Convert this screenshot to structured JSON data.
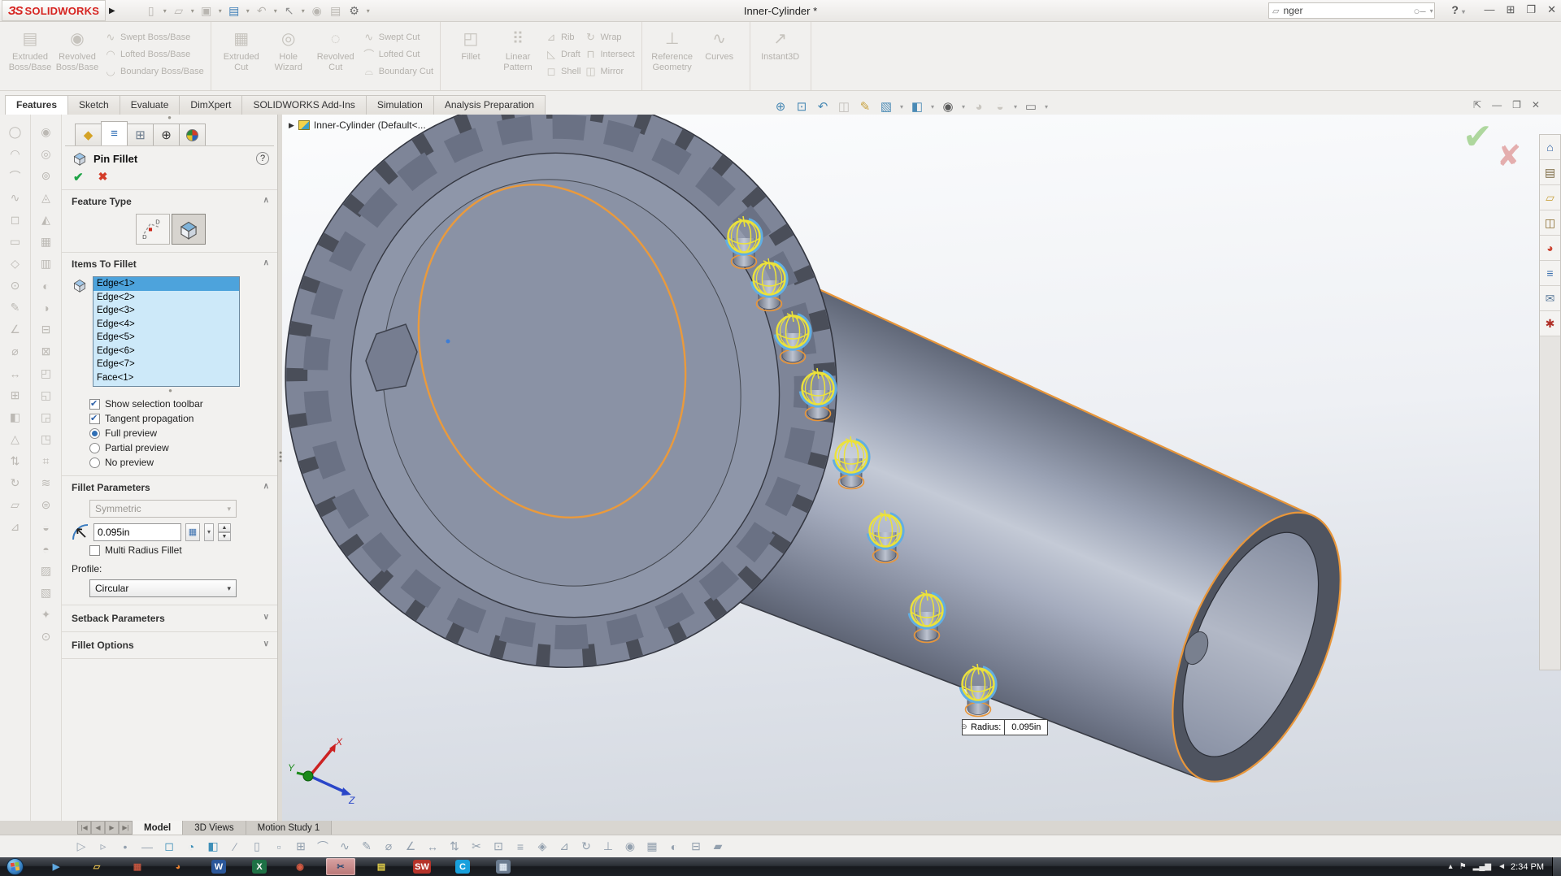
{
  "titlebar": {
    "logo_mark": "ЗS",
    "logo_name": "SOLIDWORKS",
    "expander": "▶",
    "title": "Inner-Cylinder *",
    "search_value": "nger",
    "help_label": "?",
    "win_minimize": "—",
    "win_split": "⊞",
    "win_restore": "❐",
    "win_close": "✕"
  },
  "qat": {
    "icons": [
      {
        "name": "new-document-button",
        "glyph": "▯"
      },
      {
        "name": "caret-icon",
        "glyph": "▾"
      },
      {
        "name": "open-button",
        "glyph": "▱"
      },
      {
        "name": "caret-icon",
        "glyph": "▾"
      },
      {
        "name": "save-button",
        "glyph": "▣"
      },
      {
        "name": "caret-icon",
        "glyph": "▾"
      },
      {
        "name": "print-button",
        "glyph": "▤",
        "color": "#3e7fb8"
      },
      {
        "name": "caret-icon",
        "glyph": "▾"
      },
      {
        "name": "undo-button",
        "glyph": "↶"
      },
      {
        "name": "caret-icon",
        "glyph": "▾"
      },
      {
        "name": "select-button",
        "glyph": "↖",
        "color": "#8f8f8f"
      },
      {
        "name": "caret-icon",
        "glyph": "▾"
      },
      {
        "name": "toggle-button",
        "glyph": "◉"
      },
      {
        "name": "file-properties-button",
        "glyph": "▤"
      },
      {
        "name": "options-button",
        "glyph": "⚙",
        "color": "#6f6f6f"
      },
      {
        "name": "caret-icon",
        "glyph": "▾"
      }
    ]
  },
  "ribbon": {
    "groups": [
      {
        "big": [
          {
            "name": "extruded-boss-base-button",
            "glyph": "▤",
            "label": "Extruded Boss/Base"
          },
          {
            "name": "revolved-boss-base-button",
            "glyph": "◉",
            "label": "Revolved Boss/Base"
          }
        ],
        "stack": [
          {
            "name": "swept-boss-base-button",
            "glyph": "∿",
            "label": "Swept Boss/Base"
          },
          {
            "name": "lofted-boss-base-button",
            "glyph": "◠",
            "label": "Lofted Boss/Base"
          },
          {
            "name": "boundary-boss-base-button",
            "glyph": "◡",
            "label": "Boundary Boss/Base"
          }
        ]
      },
      {
        "big": [
          {
            "name": "extruded-cut-button",
            "glyph": "▦",
            "label": "Extruded Cut"
          },
          {
            "name": "hole-wizard-button",
            "glyph": "◎",
            "label": "Hole Wizard"
          },
          {
            "name": "revolved-cut-button",
            "glyph": "◌",
            "label": "Revolved Cut"
          }
        ],
        "stack": [
          {
            "name": "swept-cut-button",
            "glyph": "∿",
            "label": "Swept Cut"
          },
          {
            "name": "lofted-cut-button",
            "glyph": "⌒",
            "label": "Lofted Cut"
          },
          {
            "name": "boundary-cut-button",
            "glyph": "⌓",
            "label": "Boundary Cut"
          }
        ]
      },
      {
        "big": [
          {
            "name": "fillet-button",
            "glyph": "◰",
            "label": "Fillet"
          },
          {
            "name": "linear-pattern-button",
            "glyph": "⠿",
            "label": "Linear Pattern"
          }
        ],
        "stack": [
          {
            "name": "rib-button",
            "glyph": "⊿",
            "label": "Rib"
          },
          {
            "name": "draft-button",
            "glyph": "◺",
            "label": "Draft"
          },
          {
            "name": "shell-button",
            "glyph": "◻",
            "label": "Shell"
          }
        ],
        "stack2": [
          {
            "name": "wrap-button",
            "glyph": "↻",
            "label": "Wrap"
          },
          {
            "name": "intersect-button",
            "glyph": "⊓",
            "label": "Intersect"
          },
          {
            "name": "mirror-button",
            "glyph": "◫",
            "label": "Mirror"
          }
        ]
      },
      {
        "big": [
          {
            "name": "reference-geometry-button",
            "glyph": "⊥",
            "label": "Reference Geometry"
          },
          {
            "name": "curves-button",
            "glyph": "∿",
            "label": "Curves"
          }
        ]
      },
      {
        "big": [
          {
            "name": "instant3d-button",
            "glyph": "↗",
            "label": "Instant3D"
          }
        ]
      }
    ]
  },
  "tabs": {
    "items": [
      {
        "label": "Features",
        "active": true
      },
      {
        "label": "Sketch"
      },
      {
        "label": "Evaluate"
      },
      {
        "label": "DimXpert"
      },
      {
        "label": "SOLIDWORKS Add-Ins"
      },
      {
        "label": "Simulation"
      },
      {
        "label": "Analysis Preparation"
      }
    ]
  },
  "headsup": {
    "icons": [
      {
        "name": "zoom-fit-icon",
        "glyph": "⊕",
        "color": "#4a8ab5"
      },
      {
        "name": "zoom-area-icon",
        "glyph": "⊡",
        "color": "#4a8ab5"
      },
      {
        "name": "previous-view-icon",
        "glyph": "↶",
        "color": "#4a8ab5"
      },
      {
        "name": "section-view-icon",
        "glyph": "◫",
        "color": "#c2bfba"
      },
      {
        "name": "measure-icon",
        "glyph": "✎",
        "color": "#c8a13e"
      },
      {
        "name": "view-orientation-icon",
        "glyph": "▧",
        "color": "#4a8ab5"
      },
      {
        "name": "caret-icon",
        "glyph": "▾"
      },
      {
        "name": "display-style-icon",
        "glyph": "◧",
        "color": "#4a8ab5"
      },
      {
        "name": "caret-icon",
        "glyph": "▾"
      },
      {
        "name": "hide-show-items-icon",
        "glyph": "◉",
        "color": "#5a5a5a"
      },
      {
        "name": "caret-icon",
        "glyph": "▾"
      },
      {
        "name": "edit-appearance-icon",
        "glyph": "◕",
        "color": "#c9c6c0"
      },
      {
        "name": "apply-scene-icon",
        "glyph": "◒",
        "color": "#c9c6c0"
      },
      {
        "name": "caret-icon",
        "glyph": "▾"
      },
      {
        "name": "view-settings-icon",
        "glyph": "▭",
        "color": "#7a7a7a"
      },
      {
        "name": "caret-icon",
        "glyph": "▾"
      }
    ]
  },
  "doccontrols": {
    "pin": "⇱",
    "minimize": "—",
    "restore": "❐",
    "close": "✕"
  },
  "left_toolbar_a": {
    "icons": [
      {
        "name": "sketch-tool-icon",
        "glyph": "◯"
      },
      {
        "name": "arc-tool-icon",
        "glyph": "◠"
      },
      {
        "name": "tangent-arc-icon",
        "glyph": "⌒"
      },
      {
        "name": "spline-tool-icon",
        "glyph": "∿"
      },
      {
        "name": "rectangle-tool-icon",
        "glyph": "◻"
      },
      {
        "name": "slot-tool-icon",
        "glyph": "▭"
      },
      {
        "name": "polygon-tool-icon",
        "glyph": "◇"
      },
      {
        "name": "point-tool-icon",
        "glyph": "⊙"
      },
      {
        "name": "text-tool-icon",
        "glyph": "✎"
      },
      {
        "name": "angle-dimension-icon",
        "glyph": "∠"
      },
      {
        "name": "diameter-dimension-icon",
        "glyph": "⌀"
      },
      {
        "name": "horizontal-dimension-icon",
        "glyph": "↔"
      },
      {
        "name": "pattern-tool-icon",
        "glyph": "⊞"
      },
      {
        "name": "shaded-view-icon",
        "glyph": "◧"
      },
      {
        "name": "triangle-tool-icon",
        "glyph": "△"
      },
      {
        "name": "swap-tool-icon",
        "glyph": "⇅"
      },
      {
        "name": "rotate-tool-icon",
        "glyph": "↻"
      },
      {
        "name": "plane-tool-icon",
        "glyph": "▱"
      },
      {
        "name": "chamfer-tool-icon",
        "glyph": "⊿"
      }
    ]
  },
  "left_toolbar_b": {
    "icons": [
      {
        "name": "circle-feature-icon",
        "glyph": "◉"
      },
      {
        "name": "hole-feature-icon",
        "glyph": "◎"
      },
      {
        "name": "boss-feature-icon",
        "glyph": "⊚"
      },
      {
        "name": "pyramid-feature-icon",
        "glyph": "◬"
      },
      {
        "name": "wedge-feature-icon",
        "glyph": "◭"
      },
      {
        "name": "grid-feature-icon",
        "glyph": "▦"
      },
      {
        "name": "hatch-feature-icon",
        "glyph": "▥"
      },
      {
        "name": "half-shade-icon",
        "glyph": "◐"
      },
      {
        "name": "half-shade-right-icon",
        "glyph": "◑"
      },
      {
        "name": "minus-box-icon",
        "glyph": "⊟"
      },
      {
        "name": "cross-box-icon",
        "glyph": "⊠"
      },
      {
        "name": "corner-tl-icon",
        "glyph": "◰"
      },
      {
        "name": "corner-bl-icon",
        "glyph": "◱"
      },
      {
        "name": "corner-br-icon",
        "glyph": "◲"
      },
      {
        "name": "corner-tr-icon",
        "glyph": "◳"
      },
      {
        "name": "hash-icon",
        "glyph": "⌗"
      },
      {
        "name": "wave-icon",
        "glyph": "≋"
      },
      {
        "name": "ring-icon",
        "glyph": "⊜"
      },
      {
        "name": "bottom-shade-icon",
        "glyph": "◒"
      },
      {
        "name": "top-shade-icon",
        "glyph": "◓"
      },
      {
        "name": "diag-hatch-icon",
        "glyph": "▨"
      },
      {
        "name": "diag-hatch2-icon",
        "glyph": "▧"
      },
      {
        "name": "star-icon",
        "glyph": "✦"
      },
      {
        "name": "dot-icon",
        "glyph": "⊙"
      }
    ]
  },
  "panel": {
    "handle": "●",
    "tabs": [
      {
        "name": "panel-tab-featuremanager",
        "glyph": "◆",
        "color": "#d4a226"
      },
      {
        "name": "panel-tab-propertymanager",
        "glyph": "≡",
        "color": "#2e6db5",
        "active": true
      },
      {
        "name": "panel-tab-configurationmanager",
        "glyph": "⊞",
        "color": "#6b7b8c"
      },
      {
        "name": "panel-tab-dimxpertmanager",
        "glyph": "⊕",
        "color": "#333333"
      },
      {
        "name": "panel-tab-displaymanager",
        "glyph": "●",
        "color": "#cc3333"
      }
    ],
    "title": "Pin Fillet",
    "help": "?",
    "ok": "✔",
    "cancel": "✖",
    "feature_type_label": "Feature Type",
    "items_label": "Items To Fillet",
    "items": [
      {
        "label": "Edge<1>",
        "selected": true
      },
      {
        "label": "Edge<2>"
      },
      {
        "label": "Edge<3>"
      },
      {
        "label": "Edge<4>"
      },
      {
        "label": "Edge<5>"
      },
      {
        "label": "Edge<6>"
      },
      {
        "label": "Edge<7>"
      },
      {
        "label": "Face<1>"
      }
    ],
    "show_selection_toolbar": "Show selection toolbar",
    "tangent_propagation": "Tangent propagation",
    "full_preview": "Full preview",
    "partial_preview": "Partial preview",
    "no_preview": "No preview",
    "fillet_params_label": "Fillet Parameters",
    "symmetric": "Symmetric",
    "radius_value": "0.095in",
    "multi_radius": "Multi Radius Fillet",
    "profile_label": "Profile:",
    "profile_value": "Circular",
    "setback_label": "Setback Parameters",
    "fillet_options_label": "Fillet Options"
  },
  "viewport": {
    "tree_item": "Inner-Cylinder  (Default<...",
    "confirm_ok": "✔",
    "confirm_cancel": "✘",
    "callout": {
      "label": "Radius:",
      "value": "0.095in"
    },
    "triad": {
      "x": "X",
      "y": "Y",
      "z": "Z"
    }
  },
  "right_pane": {
    "icons": [
      {
        "name": "home-icon",
        "glyph": "⌂",
        "color": "#2b5fa3"
      },
      {
        "name": "design-library-icon",
        "glyph": "▤",
        "color": "#7a6840"
      },
      {
        "name": "file-explorer-icon",
        "glyph": "▱",
        "color": "#c9a23e"
      },
      {
        "name": "view-palette-icon",
        "glyph": "◫",
        "color": "#8a6d2f"
      },
      {
        "name": "appearances-icon",
        "glyph": "◕",
        "color": "#cc4433"
      },
      {
        "name": "custom-properties-icon",
        "glyph": "≡",
        "color": "#3a6fae"
      },
      {
        "name": "forum-icon",
        "glyph": "✉",
        "color": "#5a7a9a"
      },
      {
        "name": "solidworks-resources-icon",
        "glyph": "✱",
        "color": "#b03028"
      }
    ]
  },
  "doc_tabs": {
    "nav": [
      "|◀",
      "◀",
      "▶",
      "▶|"
    ],
    "items": [
      {
        "label": "Model",
        "active": true
      },
      {
        "label": "3D Views"
      },
      {
        "label": "Motion Study 1"
      }
    ]
  },
  "sketchbar": {
    "icons": [
      {
        "name": "select-arrow-icon",
        "glyph": "▷",
        "color": "#9aa5b1"
      },
      {
        "name": "lasso-select-icon",
        "glyph": "▹",
        "color": "#9aa5b1"
      },
      {
        "name": "point-icon",
        "glyph": "•"
      },
      {
        "name": "centerline-icon",
        "glyph": "—"
      },
      {
        "name": "square-icon",
        "glyph": "◻",
        "color": "#3e8fb8"
      },
      {
        "name": "sphere-icon",
        "glyph": "◔",
        "color": "#3e8fb8"
      },
      {
        "name": "cube-icon",
        "glyph": "◧",
        "color": "#3e8fb8"
      },
      {
        "name": "line-icon",
        "glyph": "∕"
      },
      {
        "name": "plane-icon",
        "glyph": "▯"
      },
      {
        "name": "small-rect-icon",
        "glyph": "▫"
      },
      {
        "name": "grid-icon",
        "glyph": "⊞"
      },
      {
        "name": "arc-icon",
        "glyph": "⌒"
      },
      {
        "name": "spline-icon",
        "glyph": "∿"
      },
      {
        "name": "annotate-icon",
        "glyph": "✎"
      },
      {
        "name": "diameter-icon",
        "glyph": "⌀"
      },
      {
        "name": "angle-icon",
        "glyph": "∠"
      },
      {
        "name": "horizontal-icon",
        "glyph": "↔"
      },
      {
        "name": "vertical-swap-icon",
        "glyph": "⇅"
      },
      {
        "name": "trim-icon",
        "glyph": "✂"
      },
      {
        "name": "zoom-box-icon",
        "glyph": "⊡"
      },
      {
        "name": "list-icon",
        "glyph": "≡"
      },
      {
        "name": "diamond-icon",
        "glyph": "◈"
      },
      {
        "name": "triangle-icon",
        "glyph": "⊿"
      },
      {
        "name": "rotate-icon",
        "glyph": "↻"
      },
      {
        "name": "perpendicular-icon",
        "glyph": "⊥"
      },
      {
        "name": "target-icon",
        "glyph": "◉"
      },
      {
        "name": "mesh-icon",
        "glyph": "▦"
      },
      {
        "name": "half-icon",
        "glyph": "◐"
      },
      {
        "name": "minus-icon",
        "glyph": "⊟"
      },
      {
        "name": "block-icon",
        "glyph": "▰"
      }
    ]
  },
  "taskbar": {
    "apps": [
      {
        "name": "taskbar-app-media",
        "glyph": "▶",
        "color": "#5fa8e0"
      },
      {
        "name": "taskbar-app-explorer",
        "glyph": "▱",
        "color": "#e7c04f"
      },
      {
        "name": "taskbar-app-menu",
        "glyph": "▦",
        "color": "#c0543e"
      },
      {
        "name": "taskbar-app-firefox",
        "glyph": "◕",
        "color": "#e87f2e"
      },
      {
        "name": "taskbar-app-word",
        "glyph": "W",
        "color": "#ffffff",
        "bg": "#2b579a"
      },
      {
        "name": "taskbar-app-excel",
        "glyph": "X",
        "color": "#ffffff",
        "bg": "#1e7145"
      },
      {
        "name": "taskbar-app-chrome",
        "glyph": "◉",
        "color": "#d95b43"
      },
      {
        "name": "taskbar-app-snipping-tool",
        "glyph": "✂",
        "color": "#2b4b72",
        "active": true
      },
      {
        "name": "taskbar-app-sticky-notes",
        "glyph": "▤",
        "color": "#e8d44a"
      },
      {
        "name": "taskbar-app-solidworks",
        "glyph": "SW",
        "color": "#ffffff",
        "bg": "#b5332a"
      },
      {
        "name": "taskbar-app-camtasia",
        "glyph": "C",
        "color": "#ffffff",
        "bg": "#18a0dc"
      },
      {
        "name": "taskbar-app-calculator",
        "glyph": "▦",
        "color": "#dce6f0",
        "bg": "#6b7c90"
      }
    ],
    "tray": [
      {
        "name": "tray-expand-icon",
        "glyph": "▴"
      },
      {
        "name": "tray-flag-icon",
        "glyph": "⚑"
      },
      {
        "name": "tray-network-icon",
        "glyph": "▂▄▆"
      },
      {
        "name": "tray-volume-icon",
        "glyph": "◄"
      }
    ],
    "time": "2:34 PM"
  }
}
